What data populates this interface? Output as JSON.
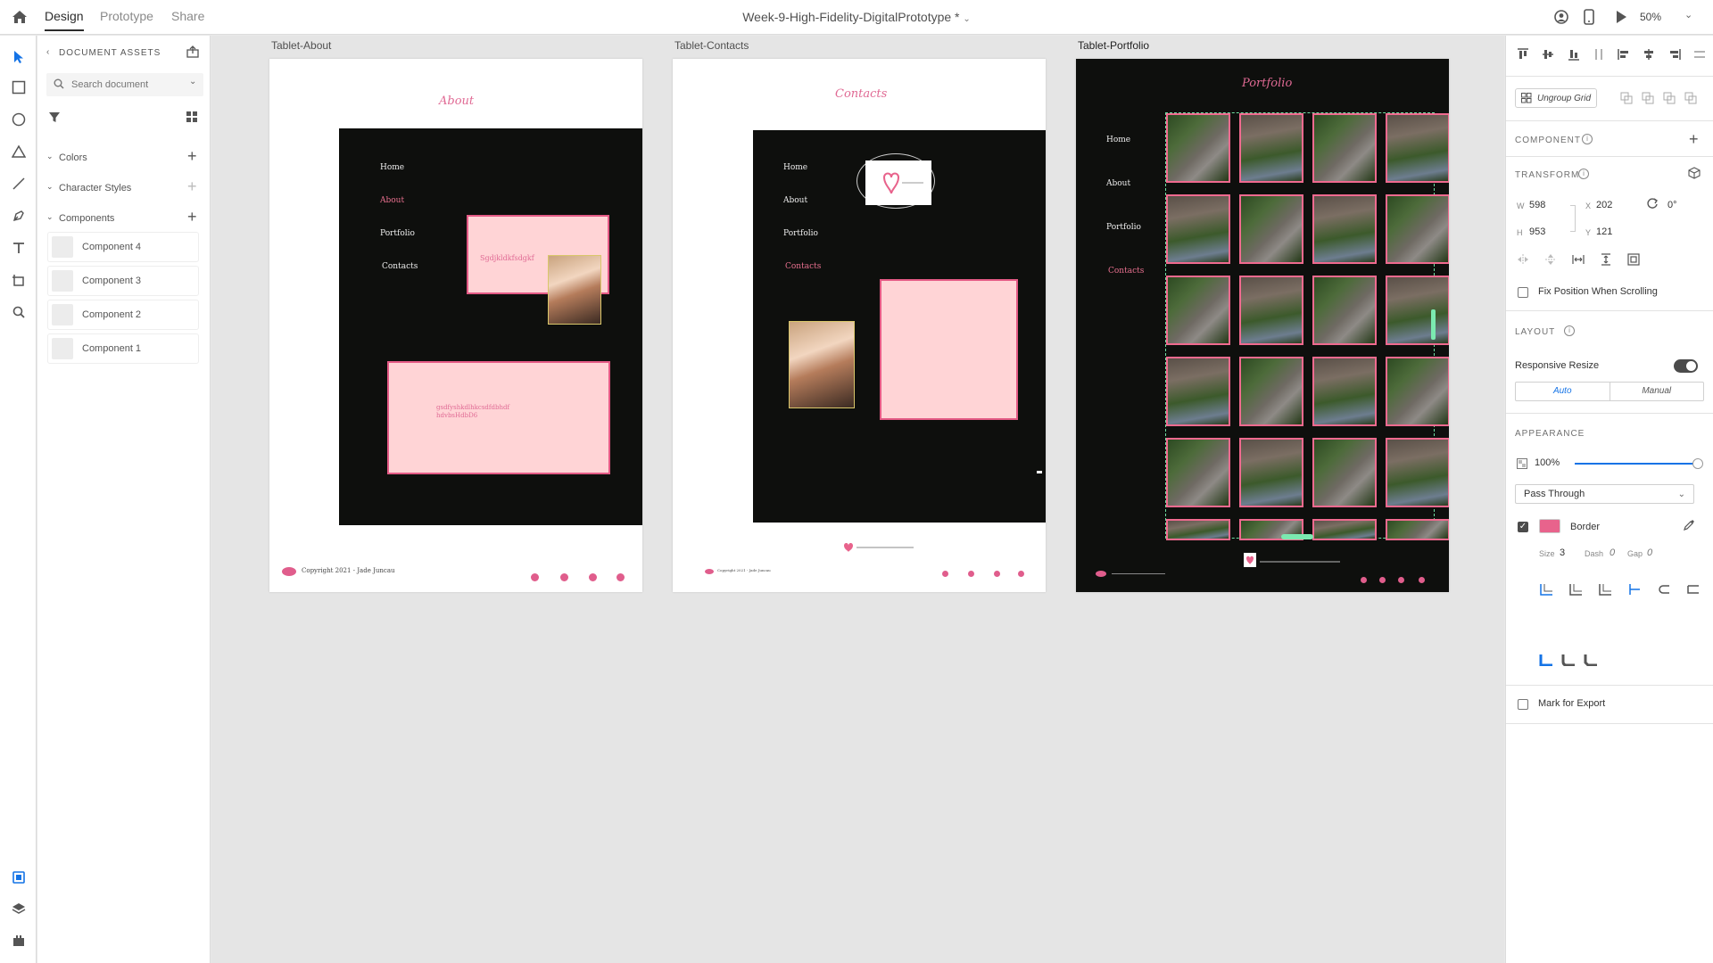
{
  "topbar": {
    "tabs": [
      "Design",
      "Prototype",
      "Share"
    ],
    "document_title": "Week-9-High-Fidelity-DigitalPrototype *",
    "zoom": "50%"
  },
  "assets": {
    "header": "DOCUMENT ASSETS",
    "search_placeholder": "Search document",
    "sections": [
      "Colors",
      "Character Styles",
      "Components"
    ],
    "components": [
      "Component 4",
      "Component 3",
      "Component 2",
      "Component 1"
    ]
  },
  "artboards": {
    "about": {
      "label": "Tablet-About",
      "title": "About",
      "nav": [
        "Home",
        "About",
        "Portfolio",
        "Contacts"
      ],
      "box1_text": "Sgdjkldkfsdgkf",
      "box2_text": "gsdfyshkdlhkcsdfdbhdf hdvbsHdbD6",
      "footer": "Copyright 2021 - Jade Juncau"
    },
    "contacts": {
      "label": "Tablet-Contacts",
      "title": "Contacts",
      "nav": [
        "Home",
        "About",
        "Portfolio",
        "Contacts"
      ],
      "footer": "Copyright 2021 - Jade Juncau"
    },
    "portfolio": {
      "label": "Tablet-Portfolio",
      "title": "Portfolio",
      "nav": [
        "Home",
        "About",
        "Portfolio",
        "Contacts"
      ]
    }
  },
  "props": {
    "ungroup": "Ungroup Grid",
    "component": "COMPONENT",
    "transform": "TRANSFORM",
    "w": "598",
    "x": "202",
    "h": "953",
    "y": "121",
    "rotation": "0°",
    "fix_position": "Fix Position When Scrolling",
    "layout": "LAYOUT",
    "responsive": "Responsive Resize",
    "auto": "Auto",
    "manual": "Manual",
    "appearance": "APPEARANCE",
    "opacity": "100%",
    "opacity_level": 1.0,
    "blend": "Pass Through",
    "border": "Border",
    "border_color": "#e8638c",
    "size_label": "Size",
    "size": "3",
    "dash_label": "Dash",
    "dash": "0",
    "gap_label": "Gap",
    "gap": "0",
    "export": "Mark for Export"
  },
  "colors": {
    "accent": "#1473e6",
    "pink": "#e8638c",
    "dark": "#0e0f0d"
  }
}
